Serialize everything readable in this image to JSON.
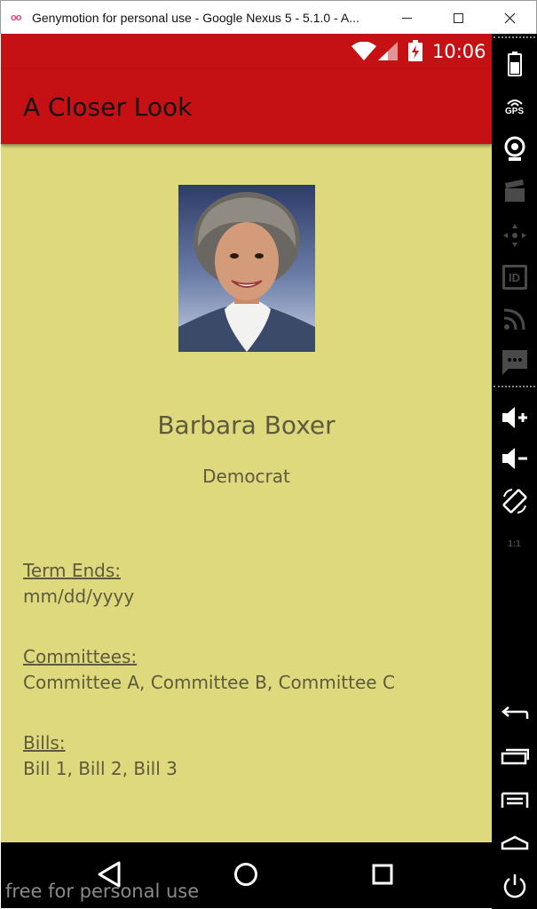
{
  "window": {
    "title": "Genymotion for personal use - Google Nexus 5 - 5.1.0 - A...",
    "logo": "oo"
  },
  "status_bar": {
    "time": "10:06",
    "icons": [
      "wifi-icon",
      "signal-icon",
      "battery-charging-icon"
    ]
  },
  "app_bar": {
    "title": "A Closer Look",
    "color": "#c61114"
  },
  "profile": {
    "name": "Barbara Boxer",
    "party": "Democrat",
    "photo_alt": "portrait-photo"
  },
  "fields": {
    "term_label": "Term Ends:",
    "term_value": "mm/dd/yyyy",
    "committees_label": "Committees:",
    "committees_value": "Committee A, Committee B, Committee C",
    "bills_label": "Bills:",
    "bills_value": "Bill 1, Bill 2, Bill 3"
  },
  "nav_bar": {
    "icons": [
      "back-icon",
      "home-icon",
      "recents-icon"
    ]
  },
  "watermark": "free for personal use",
  "genymotion_toolbar": {
    "icons": [
      "battery-icon",
      "gps-icon",
      "webcam-icon",
      "screencast-icon",
      "move-icon",
      "device-id-icon",
      "rss-icon",
      "sms-icon",
      "volume-up-icon",
      "volume-down-icon",
      "rotate-icon",
      "pixel-perfect-icon",
      "back-icon",
      "recent-apps-icon",
      "menu-icon",
      "home-icon",
      "power-icon"
    ],
    "gps_label": "GPS",
    "id_label": "ID",
    "pixel_label": "1:1"
  },
  "colors": {
    "content_bg": "#dfd97d",
    "text": "#5d5a3e"
  }
}
